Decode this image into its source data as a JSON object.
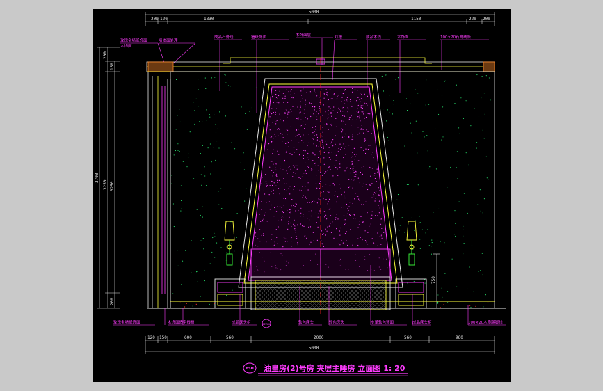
{
  "drawing": {
    "title": "油皇房(2)号房 夹层主睡房 立面图  1: 20",
    "badge": "BSH",
    "section_tag": "DETAIL",
    "overall_width_top": "5000",
    "overall_width_bottom": "5000",
    "top_dims": [
      "200",
      "120",
      "1830",
      "1150",
      "220",
      "200"
    ],
    "bottom_dims": [
      "120",
      "150",
      "600",
      "560",
      "2000",
      "560",
      "960"
    ],
    "left_dims_outer": "3700",
    "left_dims": [
      "200",
      "150",
      "3250",
      "200"
    ],
    "right_dim": "750",
    "top_notes": [
      "墙体面处理",
      "成品石膏线",
      "墙纸饰面",
      "木饰面层",
      "灯槽",
      "成品木线",
      "木饰面",
      "墙纸饰面",
      "100×20石膏线条"
    ],
    "left_notes": [
      "玫瑰金墙纸饰面",
      "木饰面"
    ],
    "bottom_notes": [
      "木饰面造型线板",
      "皮革软包饰面",
      "成品床头柜",
      "软包床头",
      "软包床头",
      "成品床头柜",
      "100×20木质踢脚线"
    ]
  }
}
